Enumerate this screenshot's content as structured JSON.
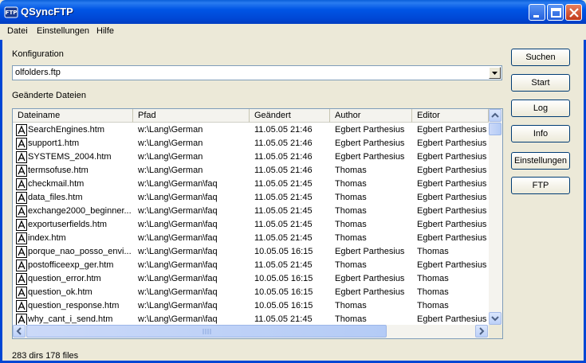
{
  "window": {
    "title": "QSyncFTP",
    "icon_text": "FTP"
  },
  "menu": [
    "Datei",
    "Einstellungen",
    "Hilfe"
  ],
  "konfiguration": {
    "label": "Konfiguration",
    "value": "olfolders.ftp"
  },
  "files": {
    "label": "Geänderte Dateien",
    "columns": [
      "Dateiname",
      "Pfad",
      "Geändert",
      "Author",
      "Editor"
    ],
    "rows": [
      [
        "SearchEngines.htm",
        "w:\\Lang\\German",
        "11.05.05 21:46",
        "Egbert Parthesius",
        "Egbert Parthesius"
      ],
      [
        "support1.htm",
        "w:\\Lang\\German",
        "11.05.05 21:46",
        "Egbert Parthesius",
        "Egbert Parthesius"
      ],
      [
        "SYSTEMS_2004.htm",
        "w:\\Lang\\German",
        "11.05.05 21:46",
        "Egbert Parthesius",
        "Egbert Parthesius"
      ],
      [
        "termsofuse.htm",
        "w:\\Lang\\German",
        "11.05.05 21:46",
        "Thomas",
        "Egbert Parthesius"
      ],
      [
        "checkmail.htm",
        "w:\\Lang\\German\\faq",
        "11.05.05 21:45",
        "Thomas",
        "Egbert Parthesius"
      ],
      [
        "data_files.htm",
        "w:\\Lang\\German\\faq",
        "11.05.05 21:45",
        "Thomas",
        "Egbert Parthesius"
      ],
      [
        "exchange2000_beginner...",
        "w:\\Lang\\German\\faq",
        "11.05.05 21:45",
        "Thomas",
        "Egbert Parthesius"
      ],
      [
        "exportuserfields.htm",
        "w:\\Lang\\German\\faq",
        "11.05.05 21:45",
        "Thomas",
        "Egbert Parthesius"
      ],
      [
        "index.htm",
        "w:\\Lang\\German\\faq",
        "11.05.05 21:45",
        "Thomas",
        "Egbert Parthesius"
      ],
      [
        "porque_nao_posso_envi...",
        "w:\\Lang\\German\\faq",
        "10.05.05 16:15",
        "Egbert Parthesius",
        "Thomas"
      ],
      [
        "postofficeexp_ger.htm",
        "w:\\Lang\\German\\faq",
        "11.05.05 21:45",
        "Thomas",
        "Egbert Parthesius"
      ],
      [
        "question_error.htm",
        "w:\\Lang\\German\\faq",
        "10.05.05 16:15",
        "Egbert Parthesius",
        "Thomas"
      ],
      [
        "question_ok.htm",
        "w:\\Lang\\German\\faq",
        "10.05.05 16:15",
        "Egbert Parthesius",
        "Thomas"
      ],
      [
        "question_response.htm",
        "w:\\Lang\\German\\faq",
        "10.05.05 16:15",
        "Thomas",
        "Thomas"
      ],
      [
        "why_cant_i_send.htm",
        "w:\\Lang\\German\\faq",
        "11.05.05 21:45",
        "Thomas",
        "Egbert Parthesius"
      ]
    ]
  },
  "buttons": {
    "suchen": "Suchen",
    "start": "Start",
    "log": "Log",
    "info": "Info",
    "einstellungen": "Einstellungen",
    "ftp": "FTP"
  },
  "status": "283 dirs 178 files"
}
